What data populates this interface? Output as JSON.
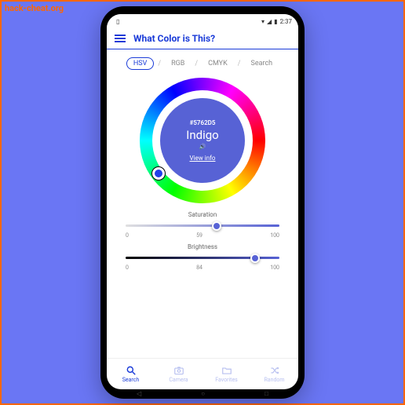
{
  "watermark": "hack-cheat.org",
  "status": {
    "time": "2:37"
  },
  "header": {
    "title": "What Color is This?"
  },
  "tabs": {
    "hsv": "HSV",
    "rgb": "RGB",
    "cmyk": "CMYK",
    "search": "Search"
  },
  "color": {
    "hex": "#5762D5",
    "name": "Indigo",
    "view_info": "View info"
  },
  "sliders": {
    "saturation": {
      "label": "Saturation",
      "min": "0",
      "value": "59",
      "max": "100",
      "percent": 59
    },
    "brightness": {
      "label": "Brightness",
      "min": "0",
      "value": "84",
      "max": "100",
      "percent": 84
    }
  },
  "nav": {
    "search": "Search",
    "camera": "Camera",
    "favorites": "Favorites",
    "random": "Random"
  }
}
